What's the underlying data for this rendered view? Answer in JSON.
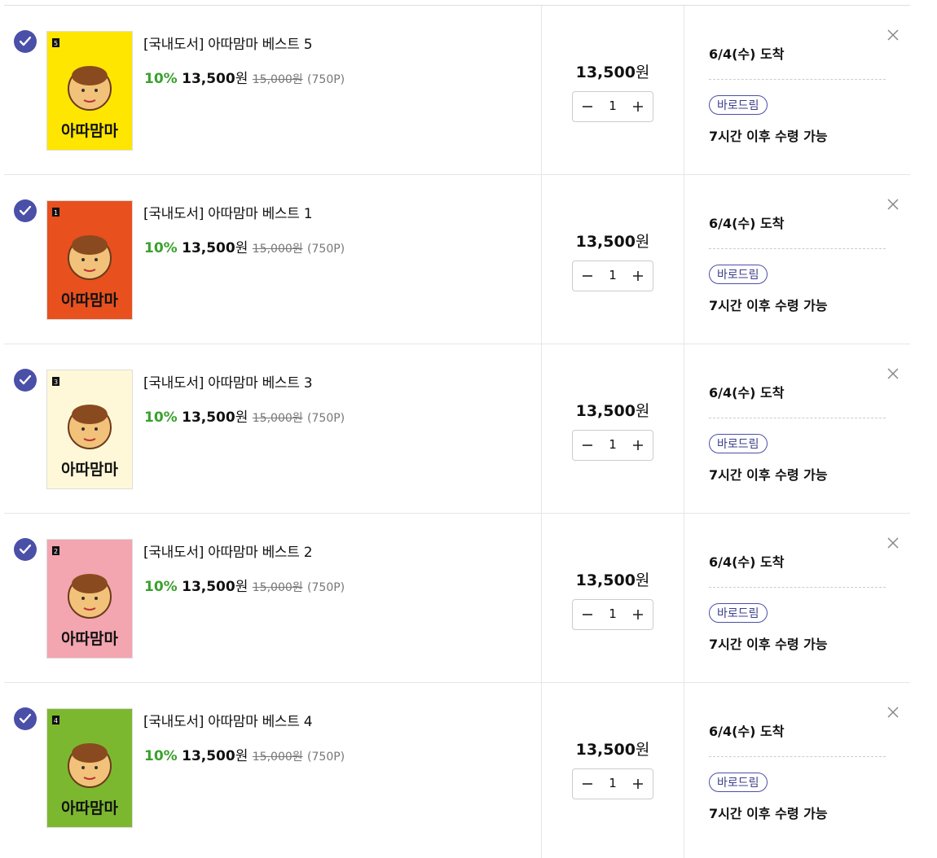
{
  "items": [
    {
      "title": "[국내도서] 아따맘마 베스트 5",
      "discount": "10%",
      "sale_price": "13,500",
      "won": "원",
      "orig_price": "15,000원",
      "points": "(750P)",
      "total": "13,500",
      "total_unit": "원",
      "qty": "1",
      "arrival": "6/4(수) 도착",
      "badge": "바로드림",
      "pickup": "7시간 이후 수령 가능",
      "cover_title": "아따맘마",
      "cover_color": "#ffe600",
      "cover_num": "5"
    },
    {
      "title": "[국내도서] 아따맘마 베스트 1",
      "discount": "10%",
      "sale_price": "13,500",
      "won": "원",
      "orig_price": "15,000원",
      "points": "(750P)",
      "total": "13,500",
      "total_unit": "원",
      "qty": "1",
      "arrival": "6/4(수) 도착",
      "badge": "바로드림",
      "pickup": "7시간 이후 수령 가능",
      "cover_title": "아따맘마",
      "cover_color": "#e8501e",
      "cover_num": "1"
    },
    {
      "title": "[국내도서] 아따맘마 베스트 3",
      "discount": "10%",
      "sale_price": "13,500",
      "won": "원",
      "orig_price": "15,000원",
      "points": "(750P)",
      "total": "13,500",
      "total_unit": "원",
      "qty": "1",
      "arrival": "6/4(수) 도착",
      "badge": "바로드림",
      "pickup": "7시간 이후 수령 가능",
      "cover_title": "아따맘마",
      "cover_color": "#fff8d8",
      "cover_num": "3"
    },
    {
      "title": "[국내도서] 아따맘마 베스트 2",
      "discount": "10%",
      "sale_price": "13,500",
      "won": "원",
      "orig_price": "15,000원",
      "points": "(750P)",
      "total": "13,500",
      "total_unit": "원",
      "qty": "1",
      "arrival": "6/4(수) 도착",
      "badge": "바로드림",
      "pickup": "7시간 이후 수령 가능",
      "cover_title": "아따맘마",
      "cover_color": "#f3a5b0",
      "cover_num": "2"
    },
    {
      "title": "[국내도서] 아따맘마 베스트 4",
      "discount": "10%",
      "sale_price": "13,500",
      "won": "원",
      "orig_price": "15,000원",
      "points": "(750P)",
      "total": "13,500",
      "total_unit": "원",
      "qty": "1",
      "arrival": "6/4(수) 도착",
      "badge": "바로드림",
      "pickup": "7시간 이후 수령 가능",
      "cover_title": "아따맘마",
      "cover_color": "#7cb82f",
      "cover_num": "4"
    }
  ],
  "colors": {
    "accent": "#4a4fa8",
    "discount": "#3aa02d"
  },
  "icons": {
    "check": "check-icon",
    "minus": "minus-icon",
    "plus": "plus-icon",
    "close": "close-icon"
  }
}
